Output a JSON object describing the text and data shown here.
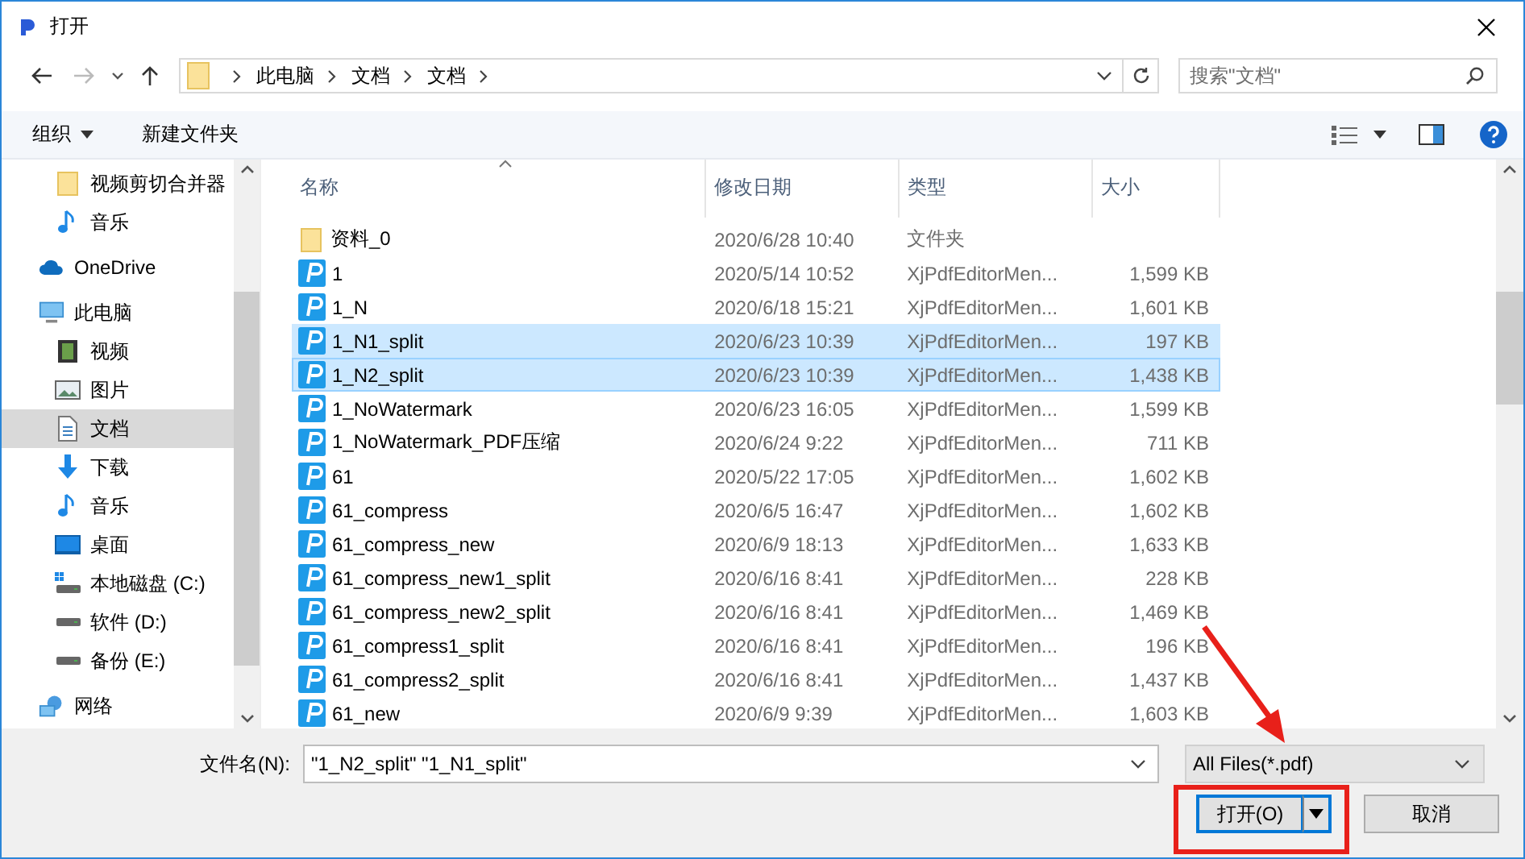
{
  "window": {
    "title": "打开"
  },
  "nav": {
    "breadcrumbs": [
      "此电脑",
      "文档",
      "文档"
    ]
  },
  "search": {
    "placeholder": "搜索\"文档\""
  },
  "toolbar": {
    "organize": "组织",
    "new_folder": "新建文件夹"
  },
  "sidebar": {
    "items_above": [
      {
        "label": "视频剪切合并器",
        "kind": "folder",
        "selected": false
      },
      {
        "label": "音乐",
        "kind": "music",
        "selected": false
      }
    ],
    "items": [
      {
        "label": "OneDrive",
        "kind": "cloud",
        "selected": false
      },
      {
        "label": "此电脑",
        "kind": "pc",
        "selected": false,
        "children": [
          {
            "label": "视频",
            "kind": "video",
            "selected": false
          },
          {
            "label": "图片",
            "kind": "picture",
            "selected": false
          },
          {
            "label": "文档",
            "kind": "document",
            "selected": true
          },
          {
            "label": "下载",
            "kind": "download",
            "selected": false
          },
          {
            "label": "音乐",
            "kind": "music",
            "selected": false
          },
          {
            "label": "桌面",
            "kind": "desktop",
            "selected": false
          },
          {
            "label": "本地磁盘 (C:)",
            "kind": "system-drive",
            "selected": false
          },
          {
            "label": "软件 (D:)",
            "kind": "drive",
            "selected": false
          },
          {
            "label": "备份 (E:)",
            "kind": "drive",
            "selected": false
          }
        ]
      },
      {
        "label": "网络",
        "kind": "network",
        "selected": false
      }
    ]
  },
  "table": {
    "columns": [
      {
        "label": "名称",
        "sorted": true
      },
      {
        "label": "修改日期",
        "sorted": false
      },
      {
        "label": "类型",
        "sorted": false
      },
      {
        "label": "大小",
        "sorted": false
      }
    ],
    "rows": [
      {
        "kind": "folder",
        "name": "资料_0",
        "date": "2020/6/28 10:40",
        "type": "文件夹",
        "selected": false,
        "focused": false
      },
      {
        "kind": "pdf",
        "name": "1",
        "date": "2020/5/14 10:52",
        "type": "XjPdfEditorMen...",
        "size": "1,599 KB",
        "selected": false,
        "focused": false
      },
      {
        "kind": "pdf",
        "name": "1_N",
        "date": "2020/6/18 15:21",
        "type": "XjPdfEditorMen...",
        "size": "1,601 KB",
        "selected": false,
        "focused": false
      },
      {
        "kind": "pdf",
        "name": "1_N1_split",
        "date": "2020/6/23 10:39",
        "type": "XjPdfEditorMen...",
        "size": "197 KB",
        "selected": true,
        "focused": false
      },
      {
        "kind": "pdf",
        "name": "1_N2_split",
        "date": "2020/6/23 10:39",
        "type": "XjPdfEditorMen...",
        "size": "1,438 KB",
        "selected": true,
        "focused": true
      },
      {
        "kind": "pdf",
        "name": "1_NoWatermark",
        "date": "2020/6/23 16:05",
        "type": "XjPdfEditorMen...",
        "size": "1,599 KB",
        "selected": false,
        "focused": false
      },
      {
        "kind": "pdf",
        "name": "1_NoWatermark_PDF压缩",
        "date": "2020/6/24 9:22",
        "type": "XjPdfEditorMen...",
        "size": "711 KB",
        "selected": false,
        "focused": false
      },
      {
        "kind": "pdf",
        "name": "61",
        "date": "2020/5/22 17:05",
        "type": "XjPdfEditorMen...",
        "size": "1,602 KB",
        "selected": false,
        "focused": false
      },
      {
        "kind": "pdf",
        "name": "61_compress",
        "date": "2020/6/5 16:47",
        "type": "XjPdfEditorMen...",
        "size": "1,602 KB",
        "selected": false,
        "focused": false
      },
      {
        "kind": "pdf",
        "name": "61_compress_new",
        "date": "2020/6/9 18:13",
        "type": "XjPdfEditorMen...",
        "size": "1,633 KB",
        "selected": false,
        "focused": false
      },
      {
        "kind": "pdf",
        "name": "61_compress_new1_split",
        "date": "2020/6/16 8:41",
        "type": "XjPdfEditorMen...",
        "size": "228 KB",
        "selected": false,
        "focused": false
      },
      {
        "kind": "pdf",
        "name": "61_compress_new2_split",
        "date": "2020/6/16 8:41",
        "type": "XjPdfEditorMen...",
        "size": "1,469 KB",
        "selected": false,
        "focused": false
      },
      {
        "kind": "pdf",
        "name": "61_compress1_split",
        "date": "2020/6/16 8:41",
        "type": "XjPdfEditorMen...",
        "size": "196 KB",
        "selected": false,
        "focused": false
      },
      {
        "kind": "pdf",
        "name": "61_compress2_split",
        "date": "2020/6/16 8:41",
        "type": "XjPdfEditorMen...",
        "size": "1,437 KB",
        "selected": false,
        "focused": false
      },
      {
        "kind": "pdf",
        "name": "61_new",
        "date": "2020/6/9 9:39",
        "type": "XjPdfEditorMen...",
        "size": "1,603 KB",
        "selected": false,
        "focused": false
      }
    ]
  },
  "file_name": {
    "label": "文件名(N):",
    "value": "\"1_N2_split\" \"1_N1_split\""
  },
  "file_type": {
    "value": "All Files(*.pdf)"
  },
  "buttons": [
    {
      "label": "打开(O)",
      "kind": "split"
    },
    {
      "label": "取消",
      "kind": "plain"
    }
  ]
}
